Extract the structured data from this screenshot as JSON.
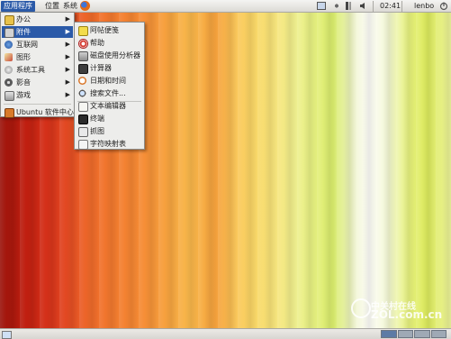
{
  "top_panel": {
    "menus": [
      "应用程序",
      "位置",
      "系统"
    ],
    "clock": "02:41",
    "user": "lenbo"
  },
  "apps_menu": {
    "items": [
      {
        "label": "办公",
        "icon": "office-icon"
      },
      {
        "label": "附件",
        "icon": "accessories-icon"
      },
      {
        "label": "互联网",
        "icon": "internet-icon"
      },
      {
        "label": "图形",
        "icon": "graphics-icon"
      },
      {
        "label": "系统工具",
        "icon": "system-tools-icon"
      },
      {
        "label": "影音",
        "icon": "multimedia-icon"
      },
      {
        "label": "游戏",
        "icon": "games-icon"
      }
    ],
    "footer": {
      "label": "Ubuntu 软件中心",
      "icon": "software-center-icon"
    }
  },
  "accessories_menu": {
    "items": [
      {
        "label": "阿帖便笺",
        "icon": "notes-icon"
      },
      {
        "label": "帮助",
        "icon": "help-icon"
      },
      {
        "label": "磁盘使用分析器",
        "icon": "disk-analyzer-icon"
      },
      {
        "label": "计算器",
        "icon": "calculator-icon"
      },
      {
        "label": "日期和时间",
        "icon": "date-time-icon"
      },
      {
        "label": "搜索文件...",
        "icon": "search-files-icon"
      },
      {
        "label": "文本编辑器",
        "icon": "text-editor-icon"
      },
      {
        "label": "终端",
        "icon": "terminal-icon"
      },
      {
        "label": "抓图",
        "icon": "screenshot-icon"
      },
      {
        "label": "字符映射表",
        "icon": "charmap-icon"
      }
    ]
  },
  "watermark": {
    "cn": "中关村在线",
    "en": "ZOL.com.cn"
  },
  "colors": {
    "menu_highlight": "#2b5aa8",
    "menu_bg": "#ededeb",
    "panel_bg": "#dcdad5"
  }
}
